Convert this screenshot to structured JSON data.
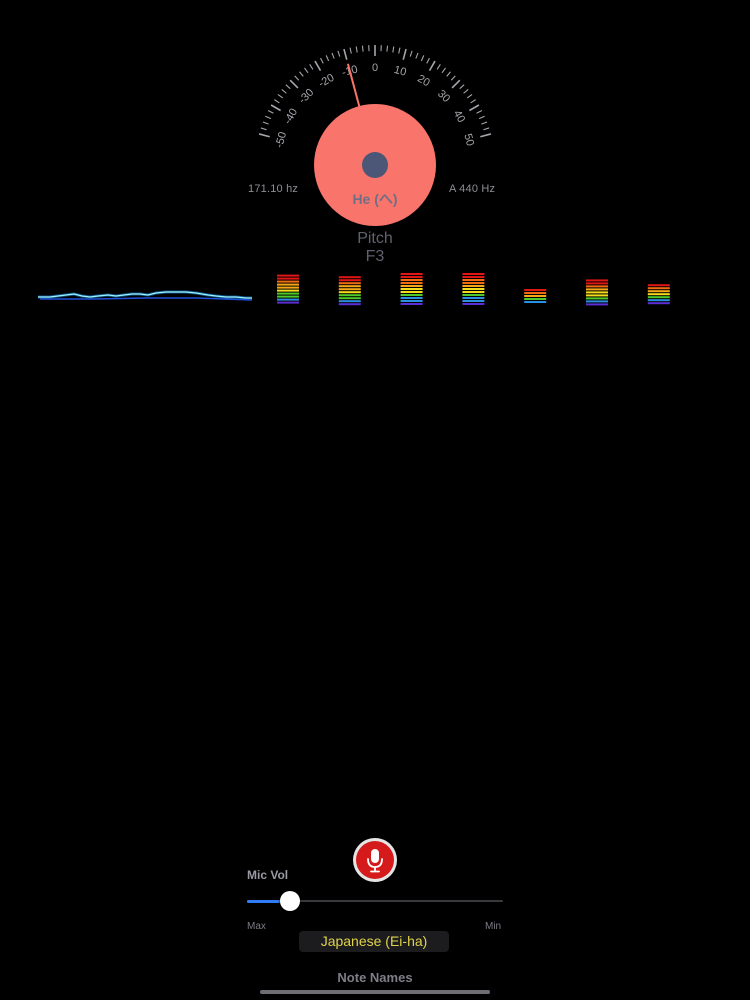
{
  "tuner": {
    "scale_labels": [
      "-50",
      "-40",
      "-30",
      "-20",
      "-10",
      "0",
      "10",
      "20",
      "30",
      "40",
      "50"
    ],
    "cents_reading": -10,
    "measured_frequency": "171.10 hz",
    "reference_pitch": "A 440 Hz",
    "note_name": "He (へ)",
    "pitch_label": "Pitch",
    "pitch_value": "F3",
    "dial_color": "#f9746b",
    "needle_color": "#f9746b",
    "hub_color": "#4c5777",
    "tick_color": "#a5a5ab"
  },
  "spectrum": {
    "bar_count": 7,
    "levels": [
      0.95,
      0.9,
      1.0,
      1.0,
      0.5,
      0.8,
      0.65
    ],
    "colors": [
      "#e01515",
      "#f06a12",
      "#f5a817",
      "#f4dc1d",
      "#4ec92a",
      "#2a8fe0",
      "#5c2fd6"
    ]
  },
  "controls": {
    "mic_icon": "microphone-icon",
    "mic_vol_label": "Mic Vol",
    "mic_vol_level": 0.13,
    "range_max_label": "Max",
    "range_min_label": "Min",
    "note_naming_value": "Japanese (Ei-ha)",
    "note_names_label": "Note Names",
    "accent_color": "#2f7cf6",
    "mic_button_color": "#d41a1a",
    "selector_text_color": "#e0d34a"
  }
}
